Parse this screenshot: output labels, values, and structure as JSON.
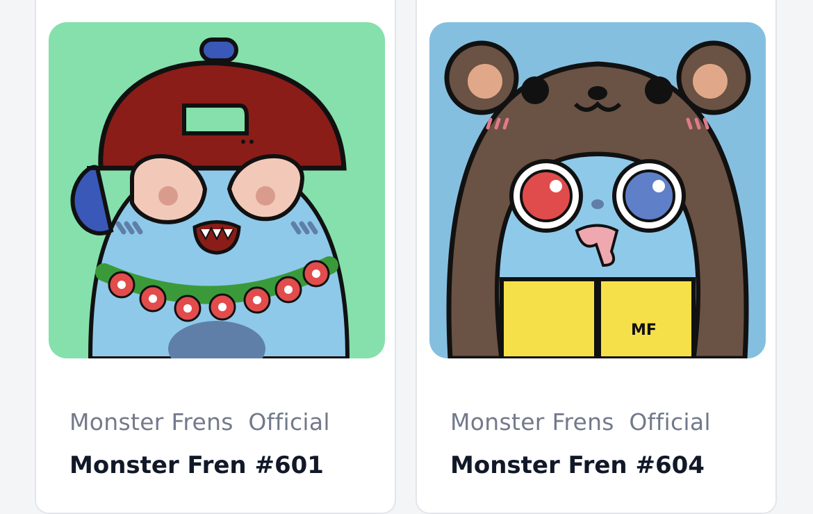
{
  "cards": [
    {
      "collection": "Monster Frens  Official",
      "name": "Monster Fren #601",
      "art_background": "#85e0ac",
      "art_description_icon": "monster-cap-glasses-flower-lei"
    },
    {
      "collection": "Monster Frens  Official",
      "name": "Monster Fren #604",
      "art_background": "#85bfe0",
      "art_description_icon": "monster-bear-hood-yellow-jacket"
    }
  ],
  "colors": {
    "card_bg": "#ffffff",
    "collection_text": "#717a8a",
    "name_text": "#111827"
  }
}
